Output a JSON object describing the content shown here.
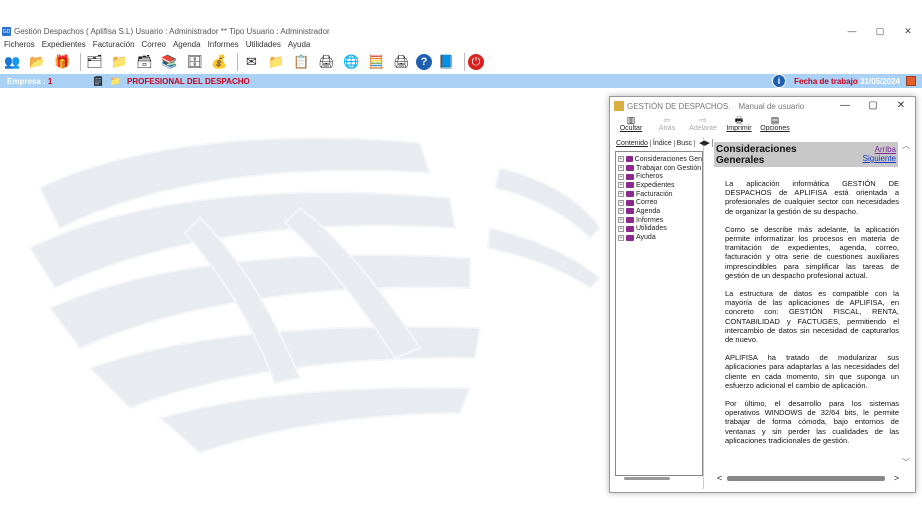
{
  "window": {
    "title": "Gestión Despachos   ( Aplifisa S.L)   Usuario : Administrador  **  Tipo Usuario : Administrador",
    "icon_text": "GD",
    "controls": [
      "—",
      "▢",
      "✕"
    ]
  },
  "menu": [
    "Ficheros",
    "Expedientes",
    "Facturación",
    "Correo",
    "Agenda",
    "Informes",
    "Utilidades",
    "Ayuda"
  ],
  "toolbar": [
    {
      "icon": "people-icon",
      "glyph": "👥"
    },
    {
      "icon": "folder-open-icon",
      "glyph": "📂"
    },
    {
      "icon": "gift-icon",
      "glyph": "🎁"
    },
    {
      "icon": "folders-icon",
      "glyph": "🗂"
    },
    {
      "icon": "folder-hands-icon",
      "glyph": "📁"
    },
    {
      "icon": "folder-doc-icon",
      "glyph": "🗃"
    },
    {
      "icon": "books-icon",
      "glyph": "📚"
    },
    {
      "icon": "archive-icon",
      "glyph": "🗄"
    },
    {
      "icon": "money-bag-icon",
      "glyph": "💰"
    },
    {
      "icon": "mail-icon",
      "glyph": "✉"
    },
    {
      "icon": "folder-icon",
      "glyph": "📁"
    },
    {
      "icon": "list-icon",
      "glyph": "📋"
    },
    {
      "icon": "printer-doc-icon",
      "glyph": "🖨"
    },
    {
      "icon": "globe-search-icon",
      "glyph": "🌐"
    },
    {
      "icon": "calculator-icon",
      "glyph": "🧮"
    },
    {
      "icon": "printer-icon",
      "glyph": "🖨"
    },
    {
      "icon": "help-icon",
      "glyph": "?"
    },
    {
      "icon": "book-icon",
      "glyph": "📘"
    },
    {
      "icon": "power-icon",
      "glyph": "⏻"
    }
  ],
  "statusbar": {
    "empresa_label": "Empresa :",
    "empresa_value": "1",
    "despacho": "PROFESIONAL DEL DESPACHO",
    "fecha_label": "Fecha de trabajo",
    "fecha_value": "31/05/2024"
  },
  "help": {
    "title": "GESTIÓN DE DESPACHOS.",
    "subtitle": "Manual de usuario",
    "toolbar": [
      {
        "label": "Ocultar",
        "underline": "O",
        "glyph": "▥",
        "enabled": true
      },
      {
        "label": "Atrás",
        "glyph": "⇦",
        "enabled": false
      },
      {
        "label": "Adelante",
        "glyph": "⇨",
        "enabled": false
      },
      {
        "label": "Imprimir",
        "glyph": "🖶",
        "enabled": true
      },
      {
        "label": "Opciones",
        "glyph": "▤",
        "enabled": true
      }
    ],
    "nav_tabs": [
      "Contenido",
      "Índice",
      "Busc"
    ],
    "tree": [
      "Consideraciones Gen",
      "Trabajar con Gestión",
      "Ficheros",
      "Expedientes",
      "Facturación",
      "Correo",
      "Agenda",
      "Informes",
      "Utilidades",
      "Ayuda"
    ],
    "heading": "Consideraciones Generales",
    "link_arriba": "Arriba",
    "link_siguiente": "Siguiente",
    "paragraphs": [
      "La aplicación informática GESTIÓN DE DESPACHOS de APLIFISA está orientada a profesionales de cualquier sector con necesidades de organizar la gestión de su despacho.",
      "Como se describe más adelante, la aplicación permite informatizar los procesos en materia de tramitación de expedientes, agenda, correo, facturación y otra serie de cuestiones auxiliares imprescindibles para simplificar las tareas de gestión de un despacho profesional actual.",
      "La estructura de datos es compatible con la mayoría de las aplicaciones de APLIFISA, en concreto con: GESTIÓN FISCAL, RENTA, CONTABILIDAD y FACTUGES, permitiendo el intercambio de datos sin necesidad de capturarlos de nuevo.",
      "APLIFISA ha tratado de modularizar sus aplicaciones para adaptarlas a las necesidades del cliente en cada momento, sin que suponga un esfuerzo adicional el cambio de aplicación.",
      "Por último, el desarrollo para los sistemas operativos WINDOWS de 32/64 bits, le permite trabajar de forma cómoda, bajo entornos de ventanas y sin perder las cualidades de las aplicaciones tradicionales de gestión."
    ]
  }
}
